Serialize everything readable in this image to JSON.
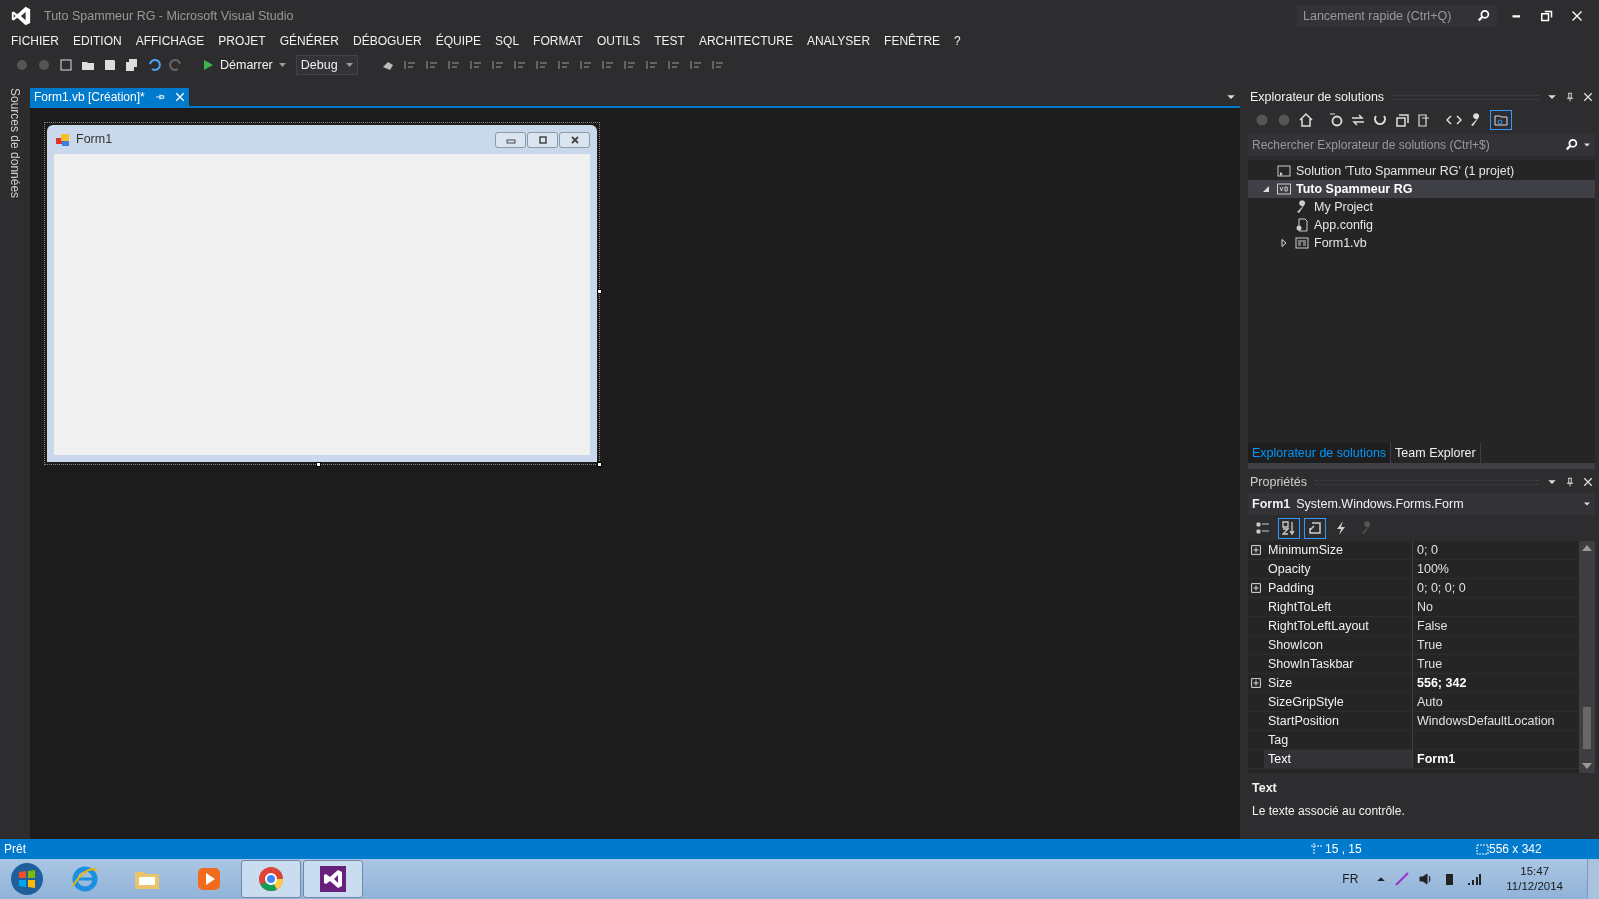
{
  "window": {
    "title": "Tuto Spammeur RG - Microsoft Visual Studio",
    "quick_launch": {
      "placeholder": "Lancement rapide (Ctrl+Q)"
    }
  },
  "menu": [
    "FICHIER",
    "EDITION",
    "AFFICHAGE",
    "PROJET",
    "GÉNÉRER",
    "DÉBOGUER",
    "ÉQUIPE",
    "SQL",
    "FORMAT",
    "OUTILS",
    "TEST",
    "ARCHITECTURE",
    "ANALYSER",
    "FENÊTRE",
    "?"
  ],
  "toolbar": {
    "start_label": "Démarrer",
    "configuration": "Debug"
  },
  "side_strip": {
    "label": "Sources de données"
  },
  "document_tabs": [
    {
      "label": "Form1.vb [Création]*",
      "selected": true
    }
  ],
  "designer_form": {
    "title": "Form1"
  },
  "solution_explorer": {
    "title": "Explorateur de solutions",
    "search": {
      "placeholder": "Rechercher Explorateur de solutions (Ctrl+$)"
    },
    "tree": [
      {
        "label": "Solution 'Tuto Spammeur RG' (1 projet)",
        "kind": "solution",
        "bold": false,
        "selected": false,
        "children": [
          {
            "label": "Tuto Spammeur RG",
            "kind": "project",
            "bold": true,
            "selected": true,
            "expanded": true,
            "children": [
              {
                "label": "My Project",
                "kind": "settings",
                "bold": false,
                "selected": false
              },
              {
                "label": "App.config",
                "kind": "config",
                "bold": false,
                "selected": false
              },
              {
                "label": "Form1.vb",
                "kind": "form",
                "bold": false,
                "selected": false,
                "expanded": false
              }
            ]
          }
        ]
      }
    ],
    "tabs": [
      {
        "label": "Explorateur de solutions",
        "selected": true
      },
      {
        "label": "Team Explorer",
        "selected": false
      }
    ]
  },
  "properties": {
    "title": "Propriétés",
    "object_name": "Form1",
    "object_type": "System.Windows.Forms.Form",
    "toolbar": [
      {
        "selected": false
      },
      {
        "selected": true
      },
      {
        "selected": true
      },
      {
        "selected": false
      },
      {
        "selected": false
      }
    ],
    "rows": [
      {
        "name": "MinimumSize",
        "value": "0; 0",
        "expandable": true,
        "bold": false,
        "selected": false
      },
      {
        "name": "Opacity",
        "value": "100%",
        "expandable": false,
        "bold": false,
        "selected": false
      },
      {
        "name": "Padding",
        "value": "0; 0; 0; 0",
        "expandable": true,
        "bold": false,
        "selected": false
      },
      {
        "name": "RightToLeft",
        "value": "No",
        "expandable": false,
        "bold": false,
        "selected": false
      },
      {
        "name": "RightToLeftLayout",
        "value": "False",
        "expandable": false,
        "bold": false,
        "selected": false
      },
      {
        "name": "ShowIcon",
        "value": "True",
        "expandable": false,
        "bold": false,
        "selected": false
      },
      {
        "name": "ShowInTaskbar",
        "value": "True",
        "expandable": false,
        "bold": false,
        "selected": false
      },
      {
        "name": "Size",
        "value": "556; 342",
        "expandable": true,
        "bold": true,
        "selected": false
      },
      {
        "name": "SizeGripStyle",
        "value": "Auto",
        "expandable": false,
        "bold": false,
        "selected": false
      },
      {
        "name": "StartPosition",
        "value": "WindowsDefaultLocation",
        "expandable": false,
        "bold": false,
        "selected": false
      },
      {
        "name": "Tag",
        "expandable": false,
        "selected": false
      },
      {
        "name": "Text",
        "value": "Form1",
        "expandable": false,
        "bold": true,
        "selected": true
      }
    ],
    "description": {
      "title": "Text",
      "text": "Le texte associé au contrôle."
    }
  },
  "status_bar": {
    "message": "Prêt",
    "position": "15 , 15",
    "size": "556 x 342"
  },
  "taskbar": {
    "apps": [
      {
        "kind": "ie",
        "selected": false
      },
      {
        "kind": "explorer",
        "selected": false
      },
      {
        "kind": "media",
        "selected": false
      },
      {
        "kind": "chrome",
        "selected": true
      },
      {
        "kind": "vs",
        "selected": true
      }
    ],
    "language": "FR",
    "time": "15:47",
    "date": "11/12/2014"
  }
}
